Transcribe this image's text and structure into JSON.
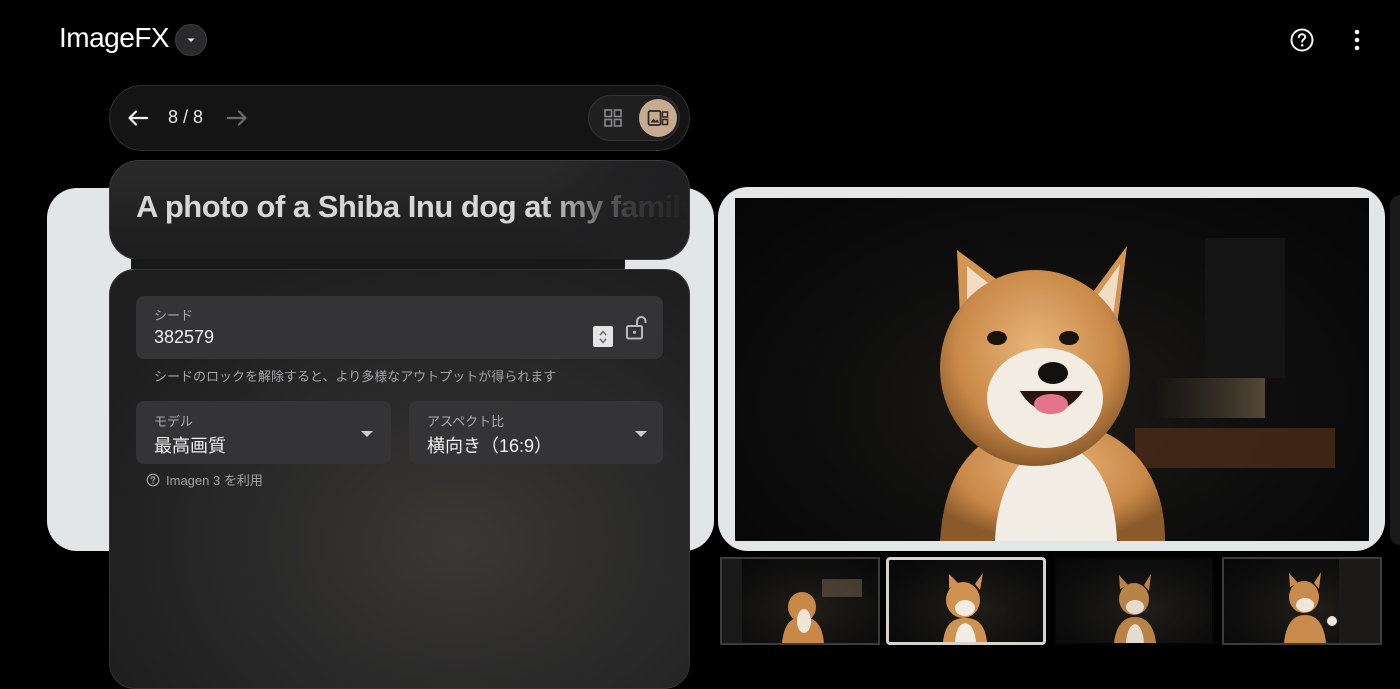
{
  "header": {
    "app_title": "ImageFX",
    "title_dropdown_icon": "caret-down-icon",
    "help_icon": "help-circle-icon",
    "more_icon": "more-vert-icon"
  },
  "navigation": {
    "counter": "8 / 8",
    "prev_icon": "arrow-left-icon",
    "next_icon": "arrow-right-icon",
    "views": [
      {
        "name": "grid-view",
        "icon": "grid-icon",
        "selected": false
      },
      {
        "name": "single-view",
        "icon": "image-detail-icon",
        "selected": true
      }
    ]
  },
  "prompt": {
    "text": "A photo of a Shiba Inu dog at my family home"
  },
  "settings": {
    "seed": {
      "label": "シード",
      "value": "382579",
      "lock_icon": "unlock-icon"
    },
    "seed_hint": "シードのロックを解除すると、より多様なアウトプットが得られます",
    "model": {
      "label": "モデル",
      "value": "最高画質"
    },
    "aspect_ratio": {
      "label": "アスペクト比",
      "value": "横向き（16:9）"
    },
    "model_note": "Imagen 3 を利用",
    "model_note_icon": "help-circle-icon"
  },
  "gallery": {
    "thumbnails": [
      {
        "name": "thumbnail-1",
        "selected": false
      },
      {
        "name": "thumbnail-2",
        "selected": true
      },
      {
        "name": "thumbnail-3",
        "selected": false
      },
      {
        "name": "thumbnail-4",
        "selected": false
      }
    ]
  },
  "colors": {
    "background": "#000000",
    "panel": "#1e1e1e",
    "field": "#343436",
    "accent_toggle": "#c7ab91",
    "frame": "#e3e6e6"
  }
}
